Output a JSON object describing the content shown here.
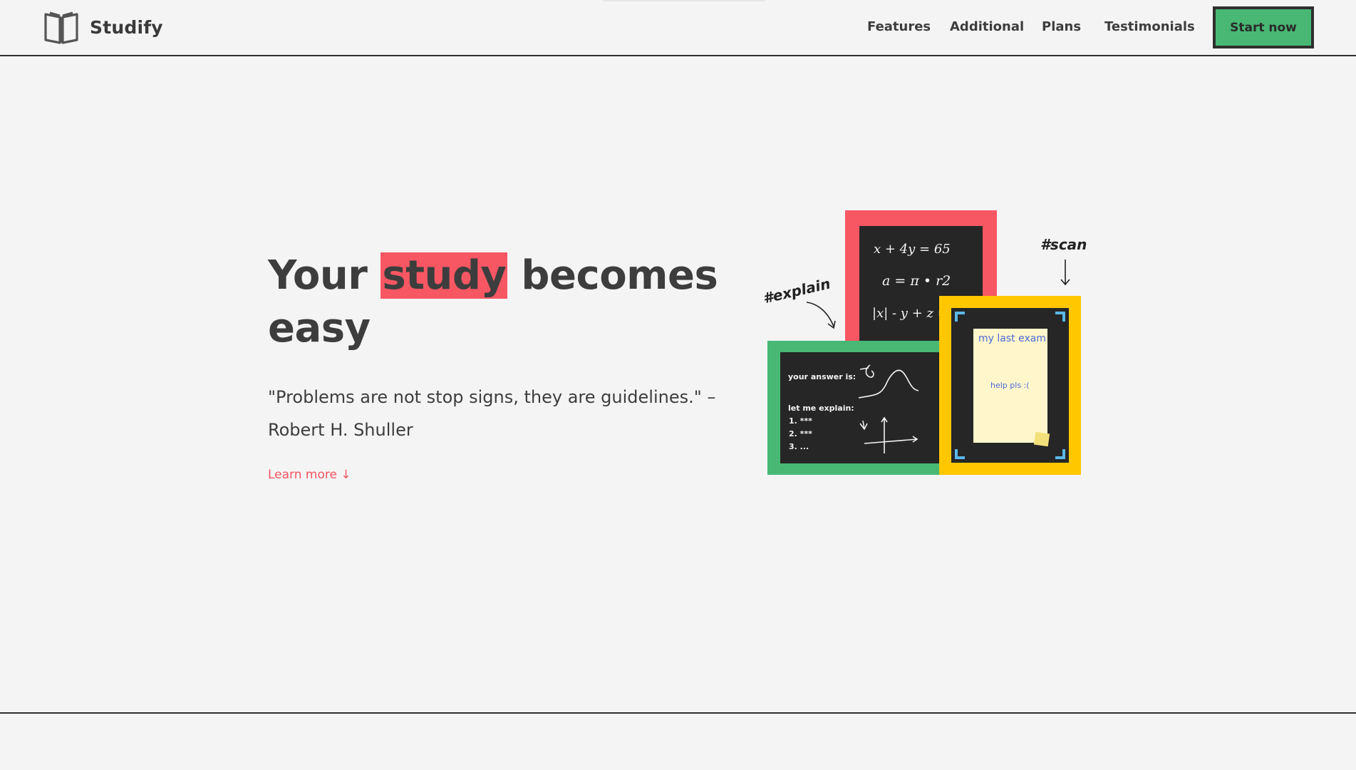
{
  "header": {
    "brand": "Studify",
    "nav": [
      {
        "label": "Features"
      },
      {
        "label": "Additional"
      },
      {
        "label": "Plans"
      },
      {
        "label": "Testimonials"
      }
    ],
    "cta_label": "Start now"
  },
  "hero": {
    "title_before": "Your ",
    "title_highlight": "study",
    "title_after": " becomes easy",
    "quote": "\"Problems are not stop signs, they are guidelines.\" – Robert H. Shuller",
    "learn_more": "Learn more ↓"
  },
  "illustration": {
    "tag_explain": "#explain",
    "tag_scan": "#scan",
    "red_board": {
      "line1": "x + 4y = 65",
      "line2": "a = π • r2",
      "line3": "|x| - y + z ="
    },
    "green_board": {
      "answer": "your answer is:",
      "explain": "let me explain:",
      "steps": [
        "1. ***",
        "2. ***",
        "3. ..."
      ]
    },
    "yellow_board": {
      "note_title": "my last exam",
      "note_text": "help pls :("
    }
  },
  "colors": {
    "accent_red": "#f75763",
    "accent_green": "#48b874",
    "accent_yellow": "#ffc700",
    "dark": "#262626"
  }
}
